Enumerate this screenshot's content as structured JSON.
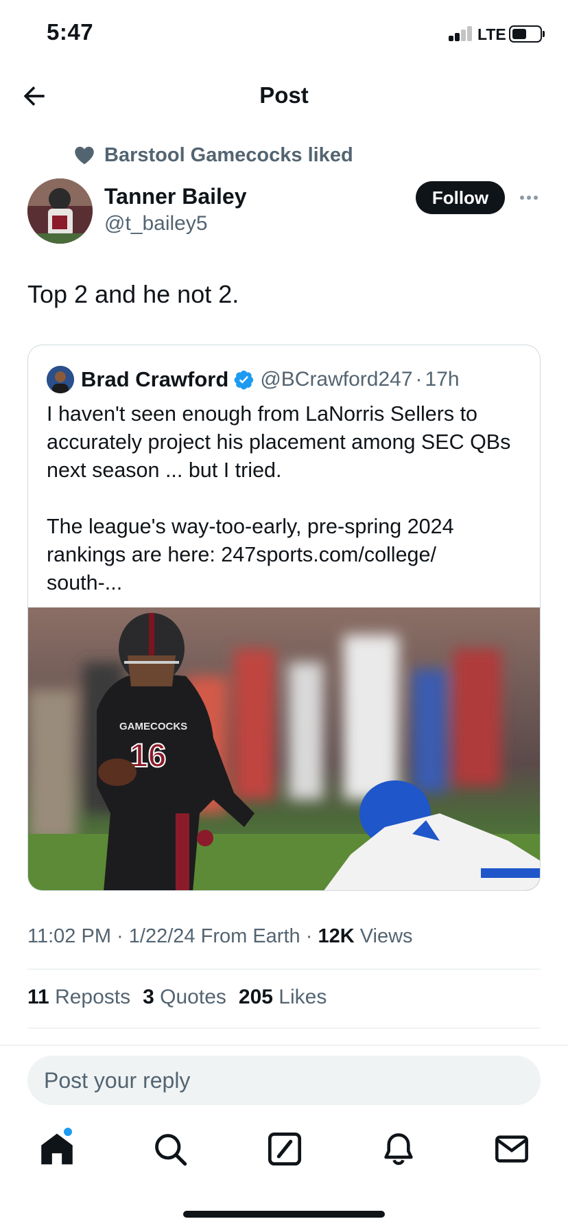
{
  "status_bar": {
    "time": "5:47",
    "network": "LTE"
  },
  "header": {
    "title": "Post"
  },
  "social_context": {
    "text": "Barstool Gamecocks liked"
  },
  "author": {
    "name": "Tanner Bailey",
    "handle": "@t_bailey5",
    "follow_label": "Follow"
  },
  "tweet": {
    "text": "Top 2 and he not 2."
  },
  "quote": {
    "name": "Brad Crawford",
    "handle": "@BCrawford247",
    "separator": "·",
    "time": "17h",
    "body_1": "I haven't seen enough from LaNorris Sellers to accurately project his placement among SEC QBs next season ... but I tried.",
    "body_2": "The league's way-too-early, pre-spring 2024 rankings are here: 247sports.com/college/\nsouth-...",
    "image_jersey": "GAMECOCKS",
    "image_number": "16"
  },
  "meta": {
    "time": "11:02 PM",
    "date": "1/22/24",
    "source": "From Earth",
    "views_count": "12K",
    "views_label": "Views",
    "sep": "·"
  },
  "stats": {
    "reposts_count": "11",
    "reposts_label": "Reposts",
    "quotes_count": "3",
    "quotes_label": "Quotes",
    "likes_count": "205",
    "likes_label": "Likes"
  },
  "reply": {
    "placeholder": "Post your reply"
  },
  "tabs": [
    "home-icon",
    "search-icon",
    "compose-icon",
    "notifications-icon",
    "messages-icon"
  ],
  "colors": {
    "accent": "#1d9bf0",
    "text": "#0f1419",
    "secondary": "#536471"
  }
}
